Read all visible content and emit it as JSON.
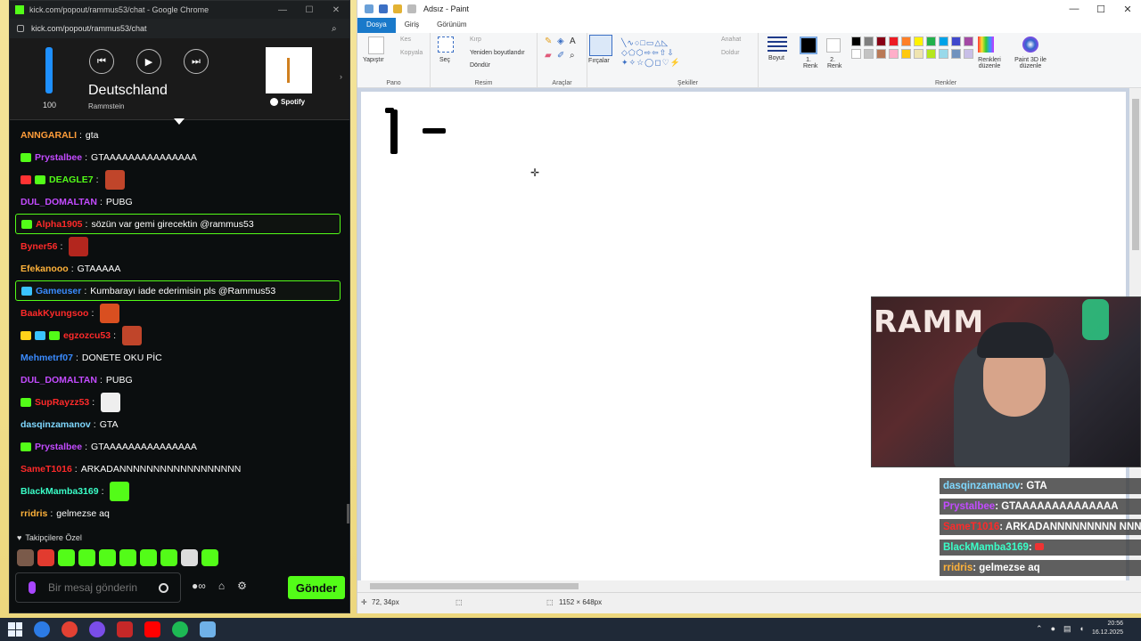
{
  "chrome": {
    "title": "kick.com/popout/rammus53/chat - Google Chrome",
    "url": "kick.com/popout/rammus53/chat",
    "zoom_icon": "zoom-icon"
  },
  "media": {
    "volume": 100,
    "volume_label": "100",
    "song_title": "Deutschland",
    "artist": "Rammstein",
    "service": "Spotify",
    "prev_icon": "⏮",
    "play_icon": "▶",
    "next_icon": "⏭"
  },
  "chat": {
    "messages": [
      {
        "user": "ANNGARALI",
        "text": "gta",
        "color": "#ff9d3a",
        "badges": [],
        "emote": null,
        "highlight": false
      },
      {
        "user": "Prystalbee",
        "text": "GTAAAAAAAAAAAAAAA",
        "color": "#c34bff",
        "badges": [
          "#53fc18"
        ],
        "emote": null,
        "highlight": false
      },
      {
        "user": "DEAGLE7",
        "text": "",
        "color": "#53fc18",
        "badges": [
          "#ff3333",
          "#53fc18"
        ],
        "emote": "#c0452a",
        "highlight": false
      },
      {
        "user": "DUL_DOMALTAN",
        "text": "PUBG",
        "color": "#c34bff",
        "badges": [],
        "emote": null,
        "highlight": false
      },
      {
        "user": "Alpha1905",
        "text": "sözün var gemi girecektin @rammus53",
        "color": "#ff2a2a",
        "badges": [
          "#53fc18"
        ],
        "emote": null,
        "highlight": true
      },
      {
        "user": "Byner56",
        "text": "",
        "color": "#ff2a2a",
        "badges": [],
        "emote": "#b3261e",
        "highlight": false
      },
      {
        "user": "Efekanooo",
        "text": "GTAAAAA",
        "color": "#ffb23a",
        "badges": [],
        "emote": null,
        "highlight": false
      },
      {
        "user": "Gameuser",
        "text": "Kumbarayı iade ederimisin pls @Rammus53",
        "color": "#3a8bff",
        "badges": [
          "#3ac3ff"
        ],
        "emote": null,
        "highlight": true
      },
      {
        "user": "BaakKyungsoo",
        "text": "",
        "color": "#ff2a2a",
        "badges": [],
        "emote": "#d94f20",
        "highlight": false
      },
      {
        "user": "egzozcu53",
        "text": "",
        "color": "#ff2a2a",
        "badges": [
          "#ffd21a",
          "#3ac3ff",
          "#53fc18"
        ],
        "emote": "#c0452a",
        "highlight": false
      },
      {
        "user": "Mehmetrf07",
        "text": "DONETE OKU PİC",
        "color": "#3a8bff",
        "badges": [],
        "emote": null,
        "highlight": false
      },
      {
        "user": "DUL_DOMALTAN",
        "text": "PUBG",
        "color": "#c34bff",
        "badges": [],
        "emote": null,
        "highlight": false
      },
      {
        "user": "SupRayzz53",
        "text": "",
        "color": "#ff2a2a",
        "badges": [
          "#53fc18"
        ],
        "emote": "#eeeeee",
        "highlight": false
      },
      {
        "user": "dasqinzamanov",
        "text": "GTA",
        "color": "#7fd8ff",
        "badges": [],
        "emote": null,
        "highlight": false
      },
      {
        "user": "Prystalbee",
        "text": "GTAAAAAAAAAAAAAAA",
        "color": "#c34bff",
        "badges": [
          "#53fc18"
        ],
        "emote": null,
        "highlight": false
      },
      {
        "user": "SameT1016",
        "text": "ARKADANNNNNNNNNNNNNNNNNN",
        "color": "#ff2a2a",
        "badges": [],
        "emote": null,
        "highlight": false
      },
      {
        "user": "BlackMamba3169",
        "text": "",
        "color": "#3affc8",
        "badges": [],
        "emote": "#53fc18",
        "highlight": false
      },
      {
        "user": "rridris",
        "text": "gelmezse aq",
        "color": "#ffb23a",
        "badges": [],
        "emote": null,
        "highlight": false
      }
    ],
    "followers_label": "Takipçilere Özel",
    "input_placeholder": "Bir mesaj gönderin",
    "send_label": "Gönder"
  },
  "paint": {
    "title": "Adsız - Paint",
    "tabs": [
      "Dosya",
      "Giriş",
      "Görünüm"
    ],
    "pano": {
      "paste": "Yapıştır",
      "cut": "Kes",
      "copy": "Kopyala",
      "label": "Pano"
    },
    "resim": {
      "select": "Seç",
      "crop": "Kırp",
      "resize": "Yeniden boyutlandır",
      "rotate": "Döndür",
      "label": "Resim"
    },
    "araclar": {
      "label": "Araçlar"
    },
    "brushes": "Fırçalar",
    "sekiller": {
      "outline": "Anahat",
      "fill": "Doldur",
      "label": "Şekiller"
    },
    "size": "Boyut",
    "color1": "1. Renk",
    "color2": "2. Renk",
    "renkler": {
      "edit": "Renkleri düzenle",
      "paint3d": "Paint 3D ile düzenle",
      "label": "Renkler"
    },
    "palette": [
      "#000000",
      "#7f7f7f",
      "#880015",
      "#ed1c24",
      "#ff7f27",
      "#fff200",
      "#22b14c",
      "#00a2e8",
      "#3f48cc",
      "#a349a4",
      "#ffffff",
      "#c3c3c3",
      "#b97a57",
      "#ffaec9",
      "#ffc90e",
      "#efe4b0",
      "#b5e61d",
      "#99d9ea",
      "#7092be",
      "#c8bfe7"
    ],
    "status": {
      "cursor_pos": "72, 34px",
      "canvas_size": "1152 × 648px"
    }
  },
  "stream_overlay": {
    "webcam_text": "RAMM",
    "messages": [
      {
        "user": "dasqinzamanov",
        "text": "GTA",
        "color": "#7fd8ff"
      },
      {
        "user": "Prystalbee",
        "text": "GTAAAAAAAAAAAAAA",
        "color": "#c34bff"
      },
      {
        "user": "SameT1016",
        "text": "ARKADANNNNNNNNN NNNNNNNNN",
        "color": "#ff2a2a"
      },
      {
        "user": "BlackMamba3169",
        "text": "",
        "color": "#3affc8"
      },
      {
        "user": "rridris",
        "text": "gelmezse aq",
        "color": "#ffb23a"
      }
    ]
  },
  "taskbar": {
    "time": "20:56",
    "date": "16.12.2025"
  }
}
